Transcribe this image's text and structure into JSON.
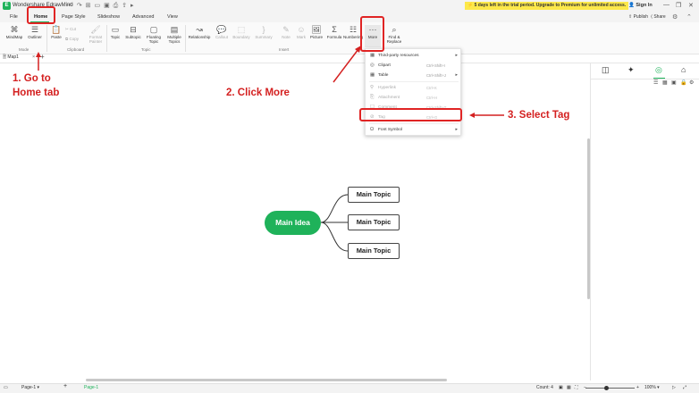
{
  "app": {
    "title": "Wondershare EdrawMind",
    "logo_letter": "E",
    "trial_notice": "5 days left in the trial period. Upgrade to Premium for unlimited access.",
    "sign_in": "Sign In"
  },
  "menu_tabs": [
    "File",
    "Home",
    "Page Style",
    "Slideshow",
    "Advanced",
    "View"
  ],
  "menu_right": {
    "publish": "Publish",
    "share": "Share"
  },
  "ribbon": {
    "mode": {
      "mindmap": "MindMap",
      "outliner": "Outliner",
      "label": "Mode"
    },
    "clipboard": {
      "paste": "Paste",
      "cut": "Cut",
      "copy": "Copy",
      "format_painter": "Format Painter",
      "label": "Clipboard"
    },
    "topic": {
      "topic": "Topic",
      "subtopic": "Subtopic",
      "floating": "Floating Topic",
      "multiple": "Multiple Topics",
      "label": "Topic"
    },
    "insert": {
      "relationship": "Relationship",
      "callout": "Callout",
      "boundary": "Boundary",
      "summary": "Summary",
      "note": "Note",
      "mark": "Mark",
      "picture": "Picture",
      "formula": "Formula",
      "numbering": "Numbering",
      "more": "More",
      "label": "Insert"
    },
    "find_replace": "Find & Replace"
  },
  "doc_tab": {
    "name": "Map1"
  },
  "dropdown": {
    "items": [
      {
        "label": "Third-party resources",
        "shortcut": "",
        "submenu": true,
        "disabled": false
      },
      {
        "label": "Clipart",
        "shortcut": "Ctrl+Shift+I",
        "submenu": false,
        "disabled": false
      },
      {
        "label": "Table",
        "shortcut": "Ctrl+Shift+J",
        "submenu": true,
        "disabled": false
      },
      {
        "label": "Hyperlink",
        "shortcut": "Ctrl+K",
        "submenu": false,
        "disabled": true
      },
      {
        "label": "Attachment",
        "shortcut": "Ctrl+H",
        "submenu": false,
        "disabled": true
      },
      {
        "label": "Comment",
        "shortcut": "Ctrl+Shift+T",
        "submenu": false,
        "disabled": true
      },
      {
        "label": "Tag",
        "shortcut": "Ctrl+G",
        "submenu": false,
        "disabled": true
      },
      {
        "label": "Font Symbol",
        "shortcut": "",
        "submenu": true,
        "disabled": false
      }
    ]
  },
  "mindmap": {
    "main_idea": "Main Idea",
    "topics": [
      "Main Topic",
      "Main Topic",
      "Main Topic"
    ]
  },
  "annotations": {
    "step1": "1. Go to\nHome tab",
    "step2": "2. Click More",
    "step3": "3. Select Tag"
  },
  "status": {
    "page_selector": "Page-1",
    "page_tab": "Page-1",
    "count": "Count: 4",
    "zoom": "100%"
  },
  "colors": {
    "accent": "#1fb25a",
    "annotation": "#d42020",
    "trial_bg": "#fde84a"
  }
}
